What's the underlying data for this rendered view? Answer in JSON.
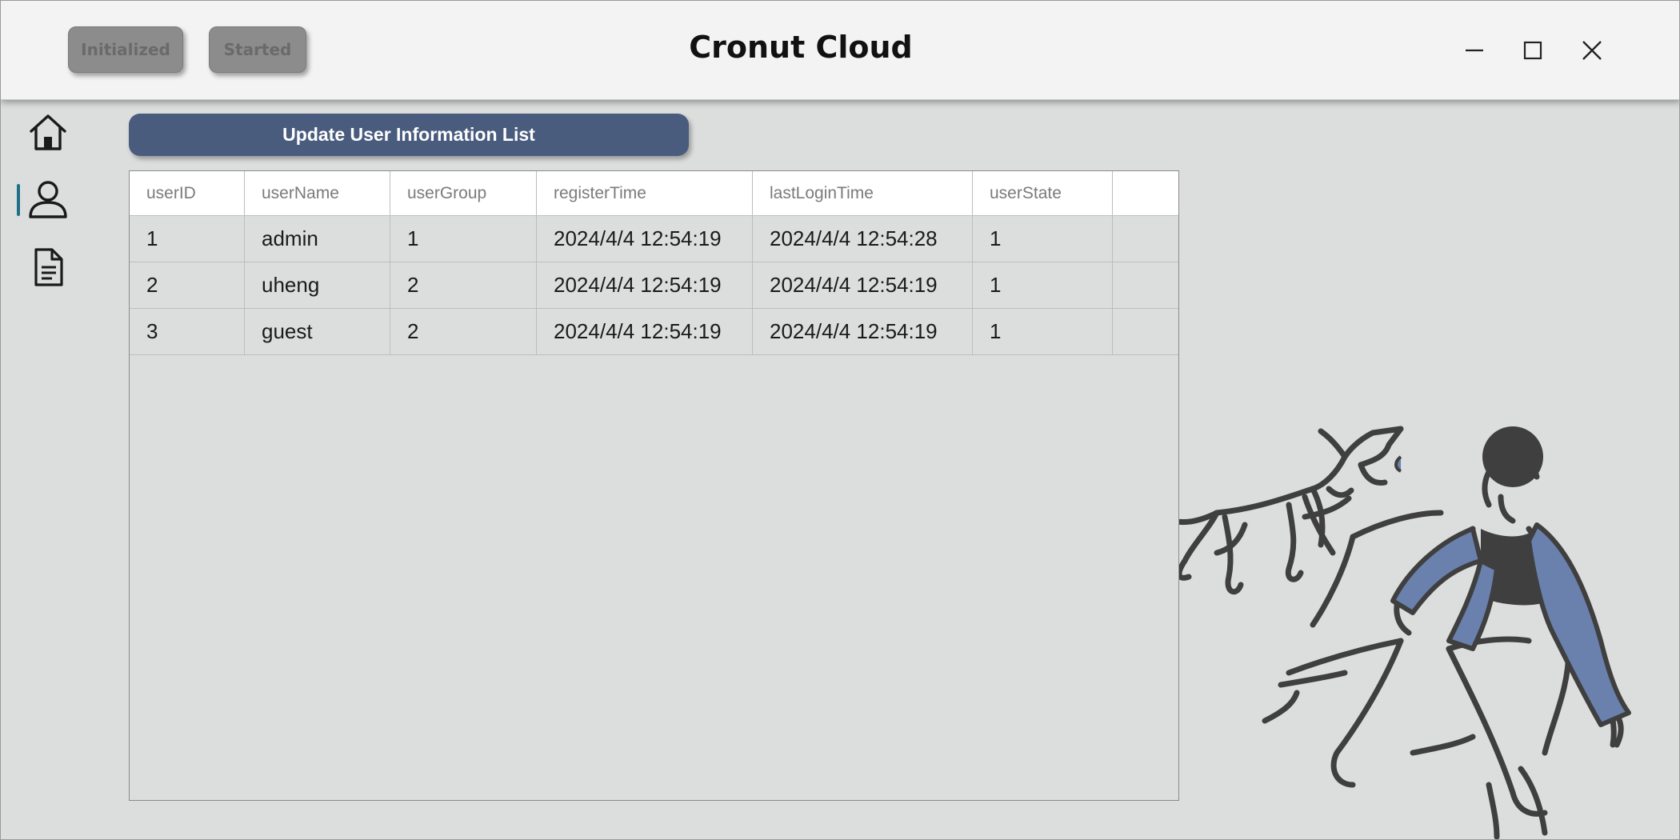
{
  "window": {
    "title": "Cronut Cloud",
    "controls": [
      "minimize-icon",
      "maximize-icon",
      "close-icon"
    ]
  },
  "status": {
    "initialized_label": "Initialized",
    "started_label": "Started"
  },
  "sidebar": {
    "items": [
      {
        "name": "home",
        "icon": "home-icon",
        "active": false
      },
      {
        "name": "user",
        "icon": "user-icon",
        "active": true
      },
      {
        "name": "document",
        "icon": "document-icon",
        "active": false
      }
    ]
  },
  "actions": {
    "update_label": "Update User Information List"
  },
  "table": {
    "columns": [
      "userID",
      "userName",
      "userGroup",
      "registerTime",
      "lastLoginTime",
      "userState",
      ""
    ],
    "rows": [
      [
        "1",
        "admin",
        "1",
        "2024/4/4 12:54:19",
        "2024/4/4 12:54:28",
        "1",
        ""
      ],
      [
        "2",
        "uheng",
        "2",
        "2024/4/4 12:54:19",
        "2024/4/4 12:54:19",
        "1",
        ""
      ],
      [
        "3",
        "guest",
        "2",
        "2024/4/4 12:54:19",
        "2024/4/4 12:54:19",
        "1",
        ""
      ]
    ]
  },
  "colors": {
    "accent": "#4a5c7e",
    "status_button": "#8c8c8c",
    "background": "#dcdddd",
    "illustration_blue": "#6a81ad",
    "illustration_dark": "#3f3f3f"
  },
  "illustration": {
    "icon": "person-running-with-dog-illustration"
  }
}
